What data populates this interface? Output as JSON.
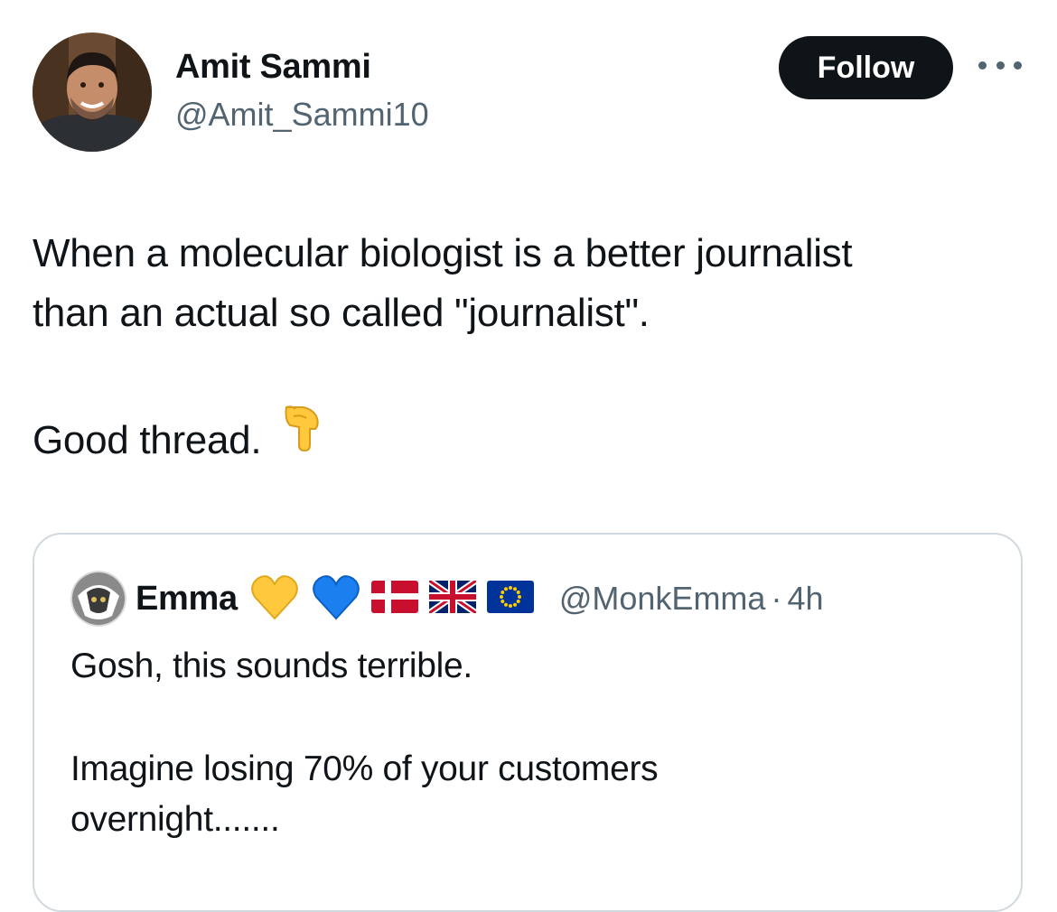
{
  "author": {
    "name": "Amit Sammi",
    "handle": "@Amit_Sammi10"
  },
  "actions": {
    "follow_label": "Follow",
    "more_icon": "more-horizontal-icon"
  },
  "tweet": {
    "line1": "When a molecular biologist is a better journalist",
    "line2": "than an actual so called \"journalist\".",
    "line3": "Good thread.",
    "emoji": "backhand-index-pointing-down-icon"
  },
  "quoted": {
    "name": "Emma",
    "name_emojis": [
      "yellow-heart-icon",
      "blue-heart-icon",
      "denmark-flag-icon",
      "uk-flag-icon",
      "eu-flag-icon"
    ],
    "handle": "@MonkEmma",
    "separator": "·",
    "time": "4h",
    "line1": "Gosh, this sounds terrible.",
    "line2": "Imagine losing 70% of your customers",
    "line3": "overnight......."
  },
  "colors": {
    "text": "#0f1419",
    "secondary": "#536471",
    "border": "#cfd9de",
    "follow_bg": "#0f1419",
    "follow_text": "#ffffff"
  }
}
